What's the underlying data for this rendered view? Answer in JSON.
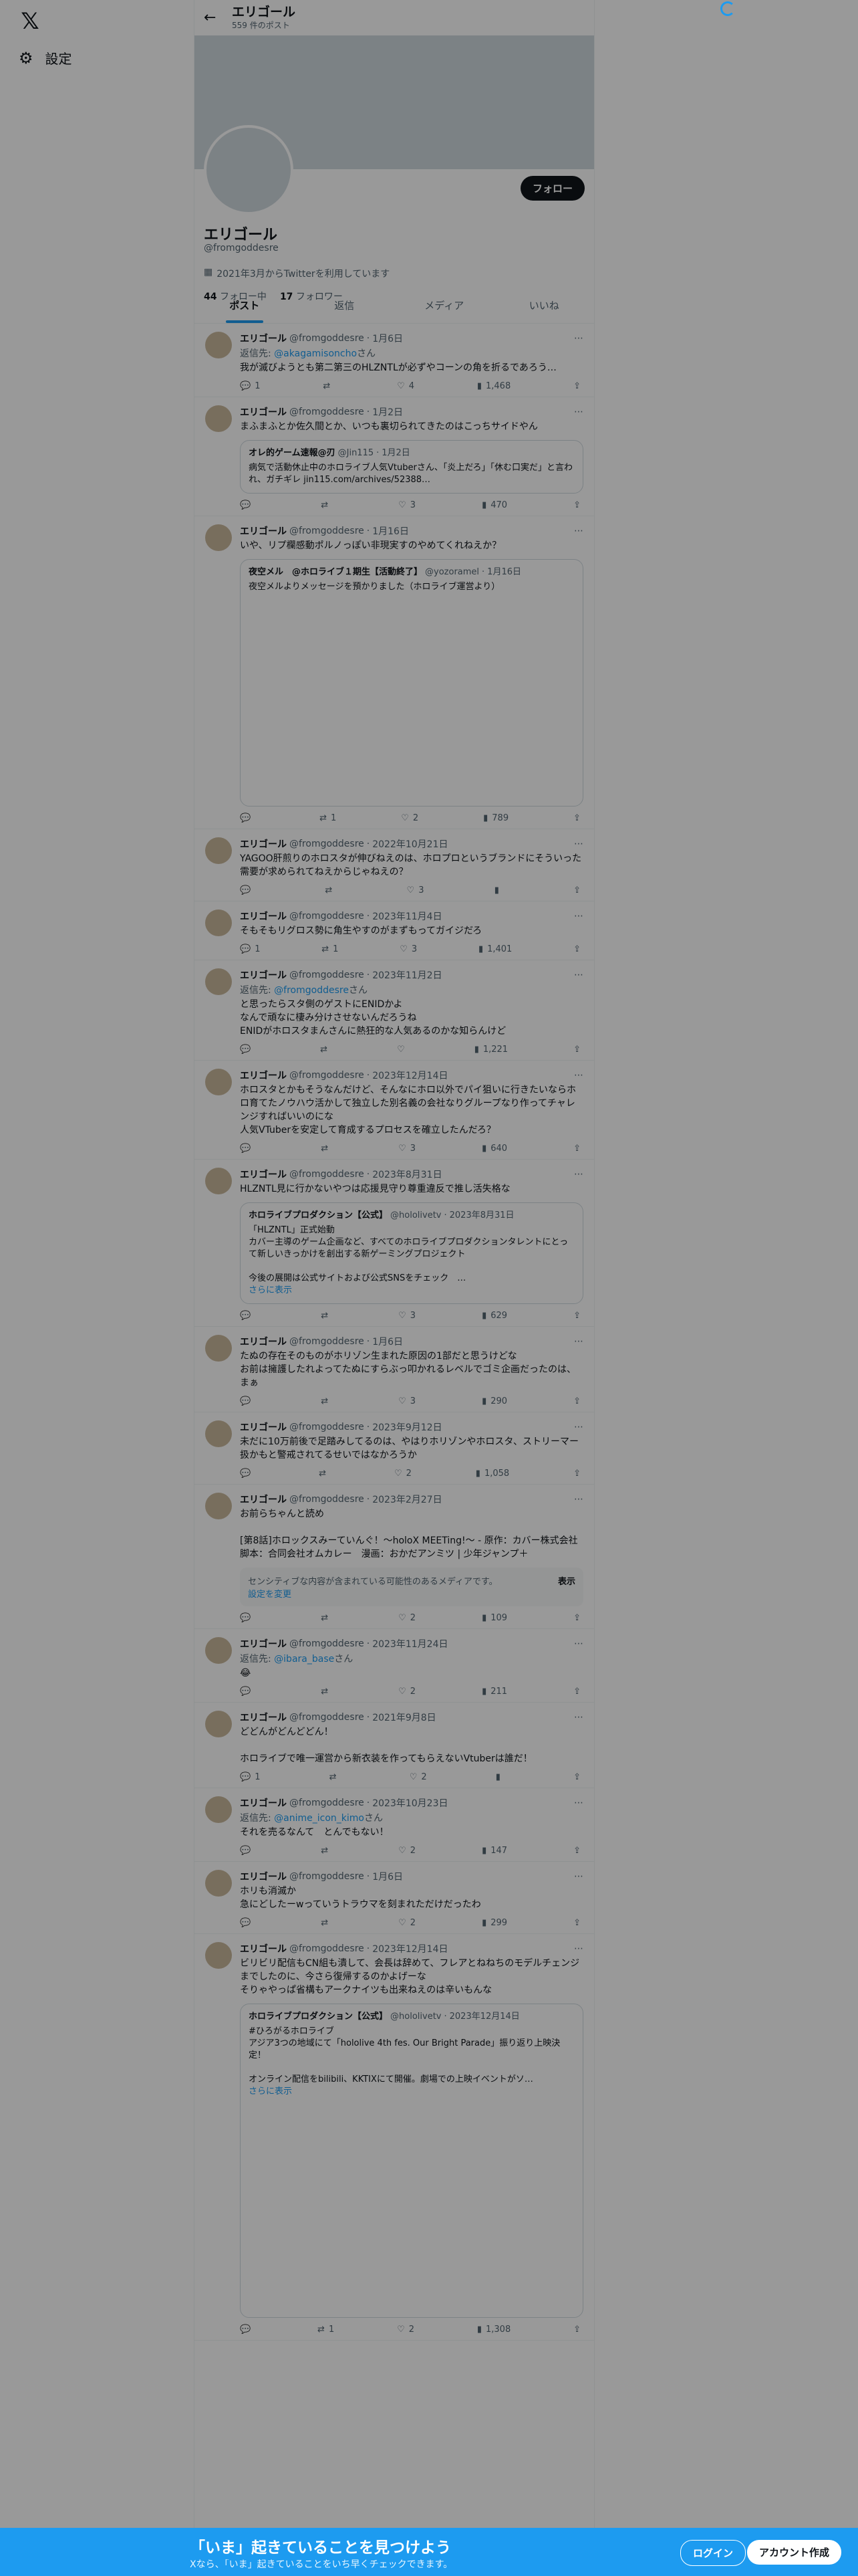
{
  "sidebar": {
    "settings_label": "設定"
  },
  "header": {
    "title": "エリゴール",
    "post_count": "559 件のポスト"
  },
  "profile": {
    "name": "エリゴール",
    "handle": "@fromgoddesre",
    "follow_label": "フォロー",
    "joined": "2021年3月からTwitterを利用しています",
    "following_count": "44",
    "following_label": "フォロー中",
    "followers_count": "17",
    "followers_label": "フォロワー"
  },
  "tabs": [
    "ポスト",
    "返信",
    "メディア",
    "いいね"
  ],
  "tweets": [
    {
      "name": "エリゴール",
      "handle": "@fromgoddesre",
      "date": "1月6日",
      "reply_to": "@akagamisoncho",
      "reply_prefix": "返信先: ",
      "reply_suffix": "さん",
      "text": "我が滅びようとも第二第三のHLZNTLが必ずやコーンの角を折るであろう…",
      "replies": "1",
      "retweets": "",
      "likes": "4",
      "views": "1,468"
    },
    {
      "name": "エリゴール",
      "handle": "@fromgoddesre",
      "date": "1月2日",
      "text": "まふまふとか佐久間とか、いつも裏切られてきたのはこっちサイドやん",
      "quote_name": "オレ的ゲーム速報@刃",
      "quote_handle": "@Jin115",
      "quote_date": "1月2日",
      "quote_text": "病気で活動休止中のホロライブ人気Vtuberさん、「炎上だろ」「休む口実だ」と言われ、ガチギレ jin115.com/archives/52388…",
      "replies": "",
      "retweets": "",
      "likes": "3",
      "views": "470"
    },
    {
      "name": "エリゴール",
      "handle": "@fromgoddesre",
      "date": "1月16日",
      "text": "いや、リプ欄感動ポルノっぽい非現実すのやめてくれねえか？",
      "quote_name": "夜空メル　@ホロライブ１期生【活動終了】",
      "quote_handle": "@yozoramel",
      "quote_date": "1月16日",
      "quote_text": "夜空メルよりメッセージを預かりました（ホロライブ運営より）",
      "replies": "",
      "retweets": "1",
      "likes": "2",
      "views": "789"
    },
    {
      "name": "エリゴール",
      "handle": "@fromgoddesre",
      "date": "2022年10月21日",
      "text": "YAGOO肝煎りのホロスタが伸びねえのは、ホロプロというブランドにそういった需要が求められてねえからじゃねえの？",
      "replies": "",
      "retweets": "",
      "likes": "3",
      "views": ""
    },
    {
      "name": "エリゴール",
      "handle": "@fromgoddesre",
      "date": "2023年11月4日",
      "text": "そもそもリグロス勢に角生やすのがまずもってガイジだろ",
      "replies": "1",
      "retweets": "1",
      "likes": "3",
      "views": "1,401"
    },
    {
      "name": "エリゴール",
      "handle": "@fromgoddesre",
      "date": "2023年11月2日",
      "reply_to": "@fromgoddesre",
      "reply_prefix": "返信先: ",
      "reply_suffix": "さん",
      "text": "と思ったらスタ側のゲストにENIDかよ\nなんで頑なに棲み分けさせないんだろうね\nENIDがホロスタまんさんに熱狂的な人気あるのかな知らんけど",
      "replies": "",
      "retweets": "",
      "likes": "",
      "views": "1,221"
    },
    {
      "name": "エリゴール",
      "handle": "@fromgoddesre",
      "date": "2023年12月14日",
      "text": "ホロスタとかもそうなんだけど、そんなにホロ以外でパイ狙いに行きたいならホロ育てたノウハウ活かして独立した別名義の会社なりグループなり作ってチャレンジすればいいのにな\n人気VTuberを安定して育成するプロセスを確立したんだろ？",
      "replies": "",
      "retweets": "",
      "likes": "3",
      "views": "640"
    },
    {
      "name": "エリゴール",
      "handle": "@fromgoddesre",
      "date": "2023年8月31日",
      "text": "HLZNTL見に行かないやつは応援見守り尊重違反で推し活失格な",
      "quote_name": "ホロライブプロダクション【公式】",
      "quote_handle": "@hololivetv",
      "quote_date": "2023年8月31日",
      "quote_text": "「HLZNTL」正式始動\nカバー主導のゲーム企画など、すべてのホロライブプロダクションタレントにとって新しいきっかけを創出する新ゲーミングプロジェクト\n\n今後の展開は公式サイトおよび公式SNSをチェック　…",
      "quote_more": "さらに表示",
      "replies": "",
      "retweets": "",
      "likes": "3",
      "views": "629"
    },
    {
      "name": "エリゴール",
      "handle": "@fromgoddesre",
      "date": "1月6日",
      "text": "たぬの存在そのものがホリゾン生まれた原因の1部だと思うけどな\nお前は擁護したれよってたぬにすらぶっ叩かれるレベルでゴミ企画だったのは、まぁ",
      "replies": "",
      "retweets": "",
      "likes": "3",
      "views": "290"
    },
    {
      "name": "エリゴール",
      "handle": "@fromgoddesre",
      "date": "2023年9月12日",
      "text": "未だに10万前後で足踏みしてるのは、やはりホリゾンやホロスタ、ストリーマー扱かもと警戒されてるせいではなかろうか",
      "replies": "",
      "retweets": "",
      "likes": "2",
      "views": "1,058"
    },
    {
      "name": "エリゴール",
      "handle": "@fromgoddesre",
      "date": "2023年2月27日",
      "text": "お前らちゃんと読め\n\n[第8話]ホロックスみーていんぐ！～holoX MEETing!～ - 原作：カバー株式会社　脚本：合同会社オムカレー　漫画：おかだアンミツ | 少年ジャンプ＋",
      "sensitive": "センシティブな内容が含まれている可能性のあるメディアです。",
      "sensitive_link": "設定を変更",
      "sensitive_show": "表示",
      "replies": "",
      "retweets": "",
      "likes": "2",
      "views": "109"
    },
    {
      "name": "エリゴール",
      "handle": "@fromgoddesre",
      "date": "2023年11月24日",
      "reply_to": "@ibara_base",
      "reply_prefix": "返信先: ",
      "reply_suffix": "さん",
      "text": "😂",
      "replies": "",
      "retweets": "",
      "likes": "2",
      "views": "211"
    },
    {
      "name": "エリゴール",
      "handle": "@fromgoddesre",
      "date": "2021年9月8日",
      "text": "どどんがどんどどん！\n\nホロライブで唯一運営から新衣装を作ってもらえないVtuberは誰だ！",
      "replies": "1",
      "retweets": "",
      "likes": "2",
      "views": ""
    },
    {
      "name": "エリゴール",
      "handle": "@fromgoddesre",
      "date": "2023年10月23日",
      "reply_to": "@anime_icon_kimo",
      "reply_prefix": "返信先: ",
      "reply_suffix": "さん",
      "text": "それを売るなんて　とんでもない！",
      "replies": "",
      "retweets": "",
      "likes": "2",
      "views": "147"
    },
    {
      "name": "エリゴール",
      "handle": "@fromgoddesre",
      "date": "1月6日",
      "text": "ホリも消滅か\n急にどしたーwっていうトラウマを刻まれただけだったわ",
      "replies": "",
      "retweets": "",
      "likes": "2",
      "views": "299"
    },
    {
      "name": "エリゴール",
      "handle": "@fromgoddesre",
      "date": "2023年12月14日",
      "text": "ビリビリ配信もCN組も潰して、会長は辞めて、フレアとねねちのモデルチェンジまでしたのに、今さら復帰するのかよげーな\nそりゃやっぱ省構もアークナイツも出来ねえのは辛いもんな",
      "quote_name": "ホロライブプロダクション【公式】",
      "quote_handle": "@hololivetv",
      "quote_date": "2023年12月14日",
      "quote_text": "#ひろがるホロライブ\nアジア3つの地域にて「hololive 4th fes. Our Bright Parade」振り返り上映決定！\n\nオンライン配信をbilibili、KKTIXにて開催。劇場での上映イベントがソ…",
      "quote_more": "さらに表示",
      "replies": "",
      "retweets": "1",
      "likes": "2",
      "views": "1,308"
    }
  ],
  "bottom": {
    "title": "「いま」起きていることを見つけよう",
    "subtitle": "Xなら、「いま」起きていることをいち早くチェックできます。",
    "login": "ログイン",
    "signup": "アカウント作成"
  }
}
